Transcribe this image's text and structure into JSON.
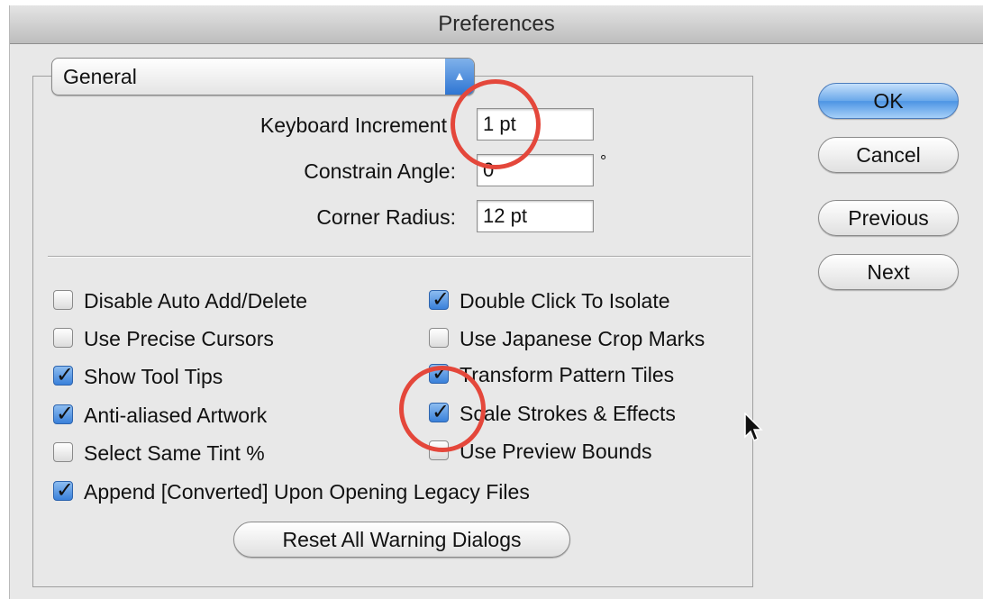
{
  "window": {
    "title": "Preferences"
  },
  "popup": {
    "selected": "General"
  },
  "fields": {
    "keyboard_increment": {
      "label": "Keyboard Increment",
      "value": "1 pt"
    },
    "constrain_angle": {
      "label": "Constrain Angle:",
      "value": "0",
      "unit": "°"
    },
    "corner_radius": {
      "label": "Corner Radius:",
      "value": "12 pt"
    }
  },
  "checkboxes": {
    "left": [
      {
        "label": "Disable Auto Add/Delete",
        "checked": false
      },
      {
        "label": "Use Precise Cursors",
        "checked": false
      },
      {
        "label": "Show Tool Tips",
        "checked": true
      },
      {
        "label": "Anti-aliased Artwork",
        "checked": true
      },
      {
        "label": "Select Same Tint %",
        "checked": false
      },
      {
        "label": "Append [Converted] Upon Opening Legacy Files",
        "checked": true
      }
    ],
    "right": [
      {
        "label": "Double Click To Isolate",
        "checked": true
      },
      {
        "label": "Use Japanese Crop Marks",
        "checked": false
      },
      {
        "label": "Transform Pattern Tiles",
        "checked": true
      },
      {
        "label": "Scale Strokes & Effects",
        "checked": true
      },
      {
        "label": "Use Preview Bounds",
        "checked": false
      }
    ]
  },
  "buttons": {
    "reset": "Reset All Warning Dialogs",
    "ok": "OK",
    "cancel": "Cancel",
    "previous": "Previous",
    "next": "Next"
  },
  "colors": {
    "accent_blue": "#3a80da",
    "annotation_red": "#e4473b"
  }
}
